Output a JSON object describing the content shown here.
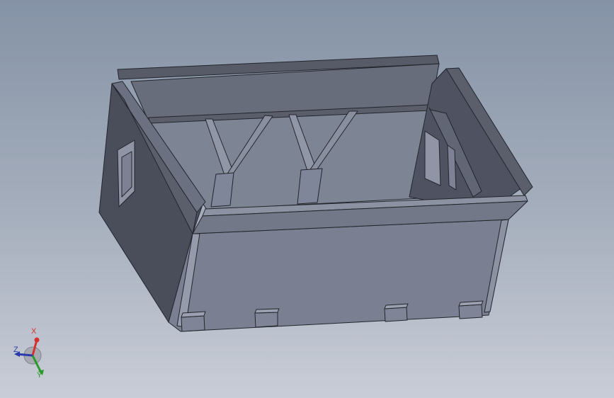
{
  "viewport": {
    "background_top": "#8593a6",
    "background_bottom": "#c9cdd7"
  },
  "model": {
    "part_shape": "open box with two internal ribs and four bottom tabs",
    "face_colors": {
      "light": "#7c8293",
      "mid": "#6a6f7e",
      "dark": "#4c505e",
      "edge": "#23252c"
    }
  },
  "triad": {
    "x_label": "X",
    "y_label": "Y",
    "z_label": "Z",
    "x_color": "#d43030",
    "y_color": "#2a9a2a",
    "z_color": "#2b3aa8"
  }
}
